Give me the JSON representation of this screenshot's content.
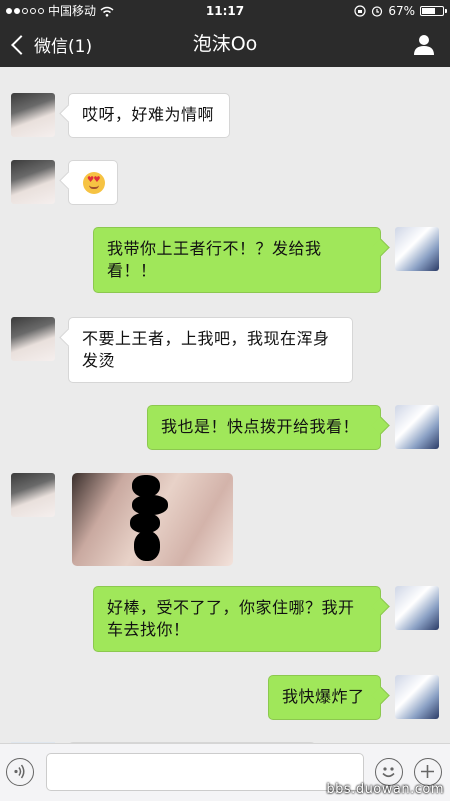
{
  "status_bar": {
    "carrier": "中国移动",
    "time": "11:17",
    "battery": "67%",
    "battery_level": 0.67
  },
  "nav": {
    "back_label": "微信(1)",
    "title": "泡沫Oo",
    "profile_icon": "person-icon"
  },
  "messages": [
    {
      "sender": "other",
      "text": "哎呀，好难为情啊"
    },
    {
      "sender": "other",
      "type": "emoji",
      "icon": "heart-eyes-emoji-icon"
    },
    {
      "sender": "self",
      "text": "我带你上王者行不！？发给我看！！"
    },
    {
      "sender": "other",
      "text": "不要上王者，上我吧，我现在浑身发烫"
    },
    {
      "sender": "self",
      "text": "我也是！快点拨开给我看！"
    },
    {
      "sender": "other",
      "type": "image",
      "icon": "censored-photo"
    },
    {
      "sender": "self",
      "text": "好棒，受不了了，你家住哪？我开车去找你！"
    },
    {
      "sender": "self",
      "text": "我快爆炸了"
    }
  ],
  "input_bar": {
    "voice_icon": "voice-icon",
    "emoji_icon": "smiley-icon",
    "plus_icon": "plus-icon"
  },
  "watermark": "bbs.duowan.com",
  "colors": {
    "nav_bg": "#2b2b2b",
    "chat_bg": "#ebebeb",
    "self_bubble": "#a0e75a",
    "other_bubble": "#ffffff"
  }
}
